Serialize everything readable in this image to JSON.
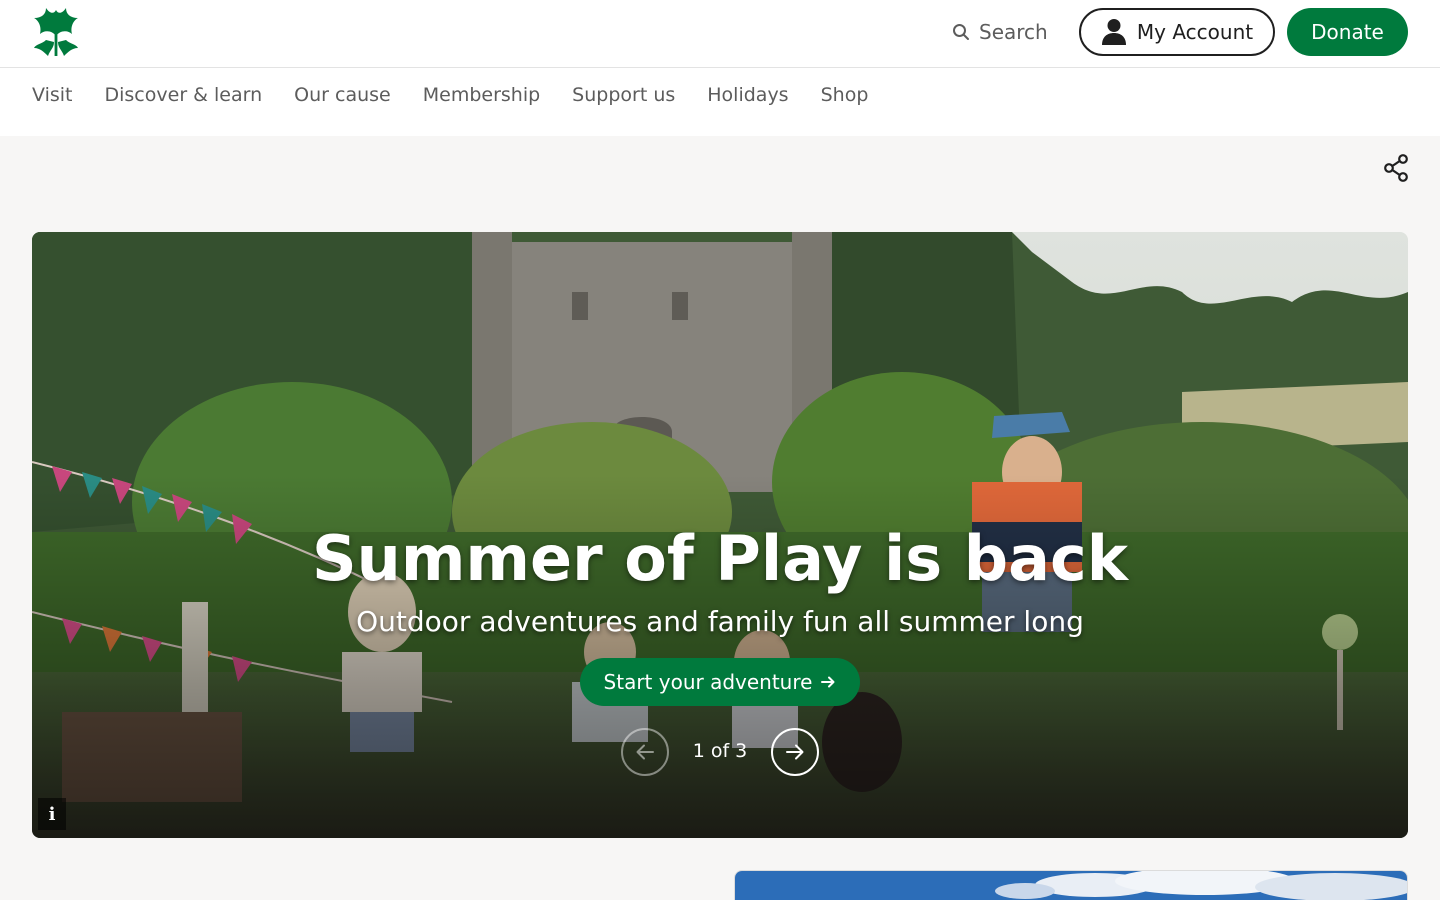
{
  "header": {
    "logo": "oak-leaf-logo",
    "search_label": "Search",
    "account_label": "My Account",
    "donate_label": "Donate"
  },
  "nav": {
    "items": [
      "Visit",
      "Discover & learn",
      "Our cause",
      "Membership",
      "Support us",
      "Holidays",
      "Shop"
    ]
  },
  "hero": {
    "title": "Summer of Play is back",
    "subtitle": "Outdoor adventures and family fun all summer long",
    "cta_label": "Start your adventure",
    "cta_icon": "arrow-right-icon",
    "counter": "1 of 3",
    "info_label": "i"
  },
  "colors": {
    "brand_green": "#007a3d",
    "nav_text": "#5c5c5c",
    "page_bg": "#f7f6f5"
  }
}
